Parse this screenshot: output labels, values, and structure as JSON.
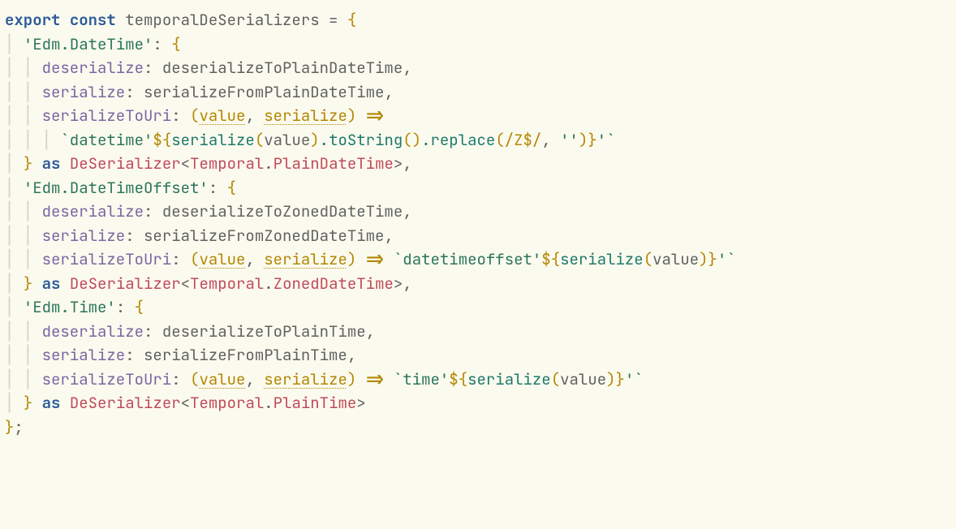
{
  "code": {
    "keywords": {
      "export": "export",
      "const": "const",
      "as": "as"
    },
    "declaration": {
      "name": "temporalDeSerializers"
    },
    "types": {
      "deserializer": "DeSerializer",
      "temporal": "Temporal",
      "plainDateTime": "PlainDateTime",
      "zonedDateTime": "ZonedDateTime",
      "plainTime": "PlainTime"
    },
    "propNames": {
      "deserialize": "deserialize",
      "serialize": "serialize",
      "serializeToUri": "serializeToUri"
    },
    "params": {
      "value": "value",
      "serialize": "serialize"
    },
    "calls": {
      "serialize": "serialize",
      "toString": "toString",
      "replace": "replace"
    },
    "entries": {
      "edmDateTime": {
        "key": "'Edm.DateTime'",
        "deserializeFn": "deserializeToPlainDateTime",
        "serializeFn": "serializeFromPlainDateTime",
        "uriPrefix": "`datetime'",
        "uriSuffix": "'`",
        "regex": "/Z$/",
        "replaceWith": "''"
      },
      "edmDateTimeOffset": {
        "key": "'Edm.DateTimeOffset'",
        "deserializeFn": "deserializeToZonedDateTime",
        "serializeFn": "serializeFromZonedDateTime",
        "uriPrefix": "`datetimeoffset'",
        "uriSuffix": "'`"
      },
      "edmTime": {
        "key": "'Edm.Time'",
        "deserializeFn": "deserializeToPlainTime",
        "serializeFn": "serializeFromPlainTime",
        "uriPrefix": "`time'",
        "uriSuffix": "'`"
      }
    },
    "punct": {
      "eq": " = ",
      "obrace": "{",
      "cbrace": "}",
      "oparen": "(",
      "cparen": ")",
      "colon": ": ",
      "comma": ",",
      "commaSp": ", ",
      "arrow": " => ",
      "lt": "<",
      "gt": ">",
      "dot": ".",
      "semicolon": ";",
      "dollarOpen": "${",
      "closeBrace": "}"
    },
    "guides": {
      "v1": "│ ",
      "v2": "│ │ ",
      "v3": "│ │ │ "
    }
  }
}
